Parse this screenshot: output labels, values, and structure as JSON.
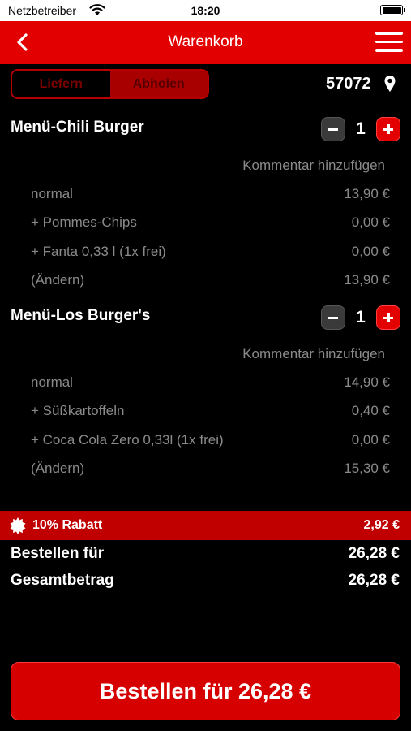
{
  "status_bar": {
    "carrier": "Netzbetreiber",
    "time": "18:20"
  },
  "header": {
    "title": "Warenkorb"
  },
  "delivery_mode": {
    "options": [
      "Liefern",
      "Abholen"
    ],
    "selected": "Abholen"
  },
  "location": {
    "zip": "57072"
  },
  "items": [
    {
      "name": "Menü-Chili Burger",
      "quantity": "1",
      "comment_label": "Kommentar hinzufügen",
      "lines": [
        {
          "label": "normal",
          "price": "13,90 €"
        },
        {
          "label": "+ Pommes-Chips",
          "price": "0,00 €"
        },
        {
          "label": "+ Fanta 0,33 l (1x frei)",
          "price": "0,00 €"
        },
        {
          "label": "(Ändern)",
          "price": "13,90 €"
        }
      ]
    },
    {
      "name": "Menü-Los Burger's",
      "quantity": "1",
      "comment_label": "Kommentar hinzufügen",
      "lines": [
        {
          "label": "normal",
          "price": "14,90 €"
        },
        {
          "label": "+ Süßkartoffeln",
          "price": "0,40 €"
        },
        {
          "label": "+ Coca Cola Zero 0,33l (1x frei)",
          "price": "0,00 €"
        },
        {
          "label": "(Ändern)",
          "price": "15,30 €"
        }
      ]
    }
  ],
  "discount": {
    "label": "10% Rabatt",
    "value": "2,92 €"
  },
  "summary": {
    "order_label": "Bestellen für",
    "order_value": "26,28 €",
    "total_label": "Gesamtbetrag",
    "total_value": "26,28 €"
  },
  "order_button": {
    "label": "Bestellen für 26,28 €"
  },
  "colors": {
    "accent": "#e30000",
    "background": "#000000",
    "muted_text": "#8a8a8a"
  },
  "icons": [
    "wifi-icon",
    "battery-icon",
    "back-chevron-icon",
    "hamburger-menu-icon",
    "location-pin-icon",
    "minus-icon",
    "plus-icon",
    "discount-badge-icon"
  ]
}
